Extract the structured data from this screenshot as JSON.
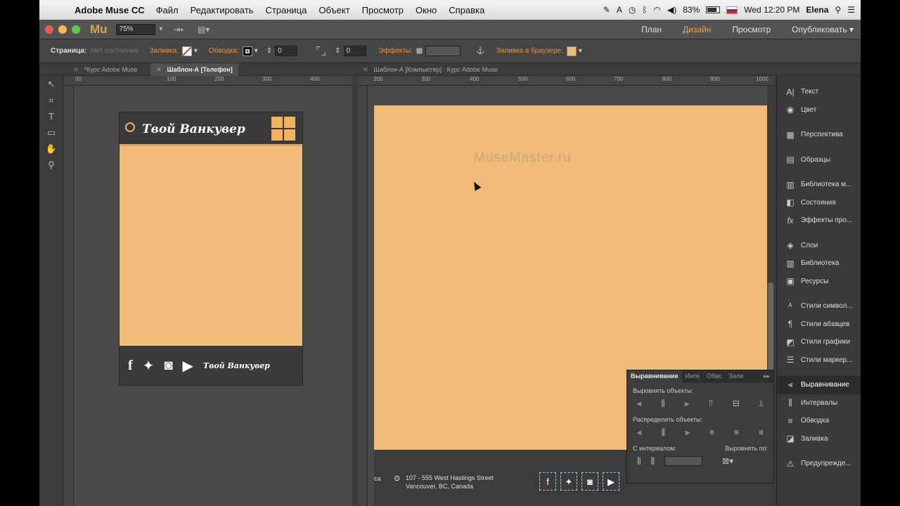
{
  "menubar": {
    "app": "Adobe Muse CC",
    "items": [
      "Файл",
      "Редактировать",
      "Страница",
      "Объект",
      "Просмотр",
      "Окно",
      "Справка"
    ],
    "battery": "83%",
    "clock": "Wed 12:20 PM",
    "user": "Elena"
  },
  "titlebar": {
    "logo": "Mu",
    "zoom": "75%",
    "modes": [
      "План",
      "Дизайн",
      "Просмотр",
      "Опубликовать"
    ],
    "active_mode": "Дизайн"
  },
  "controlbar": {
    "page_label": "Страница:",
    "page_state": "Нет состояния",
    "fill_label": "Заливка:",
    "stroke_label": "Обводка:",
    "stroke_value": "0",
    "corner_value": "0",
    "effects_label": "Эффекты:",
    "browser_fill_label": "Заливка в браузере:",
    "browser_fill_color": "#f0b87a"
  },
  "tabs": {
    "left": [
      {
        "label": "*Курс Adobe Muse",
        "active": false
      },
      {
        "label": "Шаблон-А [Телефон]",
        "active": true
      }
    ],
    "right": [
      {
        "label": "Шаблон-А [Компьютер] : Курс Adobe Muse",
        "active": true
      }
    ]
  },
  "left_ruler": [
    "00",
    "100",
    "200",
    "300",
    "400"
  ],
  "right_ruler": [
    "200",
    "300",
    "400",
    "500",
    "600",
    "700",
    "800",
    "900",
    "1000"
  ],
  "phone": {
    "title": "Твой Ванкувер",
    "footer_brand": "Твой Ванкувер",
    "accent": "#f0b25a"
  },
  "desktop": {
    "watermark": "MuseMaster.ru",
    "address_line1": "107 - 555 West Hastings Street",
    "address_line2": "Vancouver, BC, Canada",
    "cut_text": "ca"
  },
  "align_panel": {
    "tabs": [
      "Выравнивание",
      "Инте",
      "Обвс",
      "Зали"
    ],
    "align_objects": "Выровнять объекты:",
    "distribute_objects": "Распределить объекты:",
    "with_spacing": "С интервалом:",
    "align_to": "Выровнять по:"
  },
  "panels": [
    {
      "label": "Текст",
      "icon": "text-icon"
    },
    {
      "label": "Цвет",
      "icon": "palette-icon"
    },
    {
      "label": "Перспектива",
      "icon": "perspective-icon"
    },
    {
      "label": "Образцы",
      "icon": "swatches-icon"
    },
    {
      "label": "Библиотека м...",
      "icon": "library-icon"
    },
    {
      "label": "Состояния",
      "icon": "states-icon"
    },
    {
      "label": "Эффекты про...",
      "icon": "fx-icon"
    },
    {
      "label": "Слои",
      "icon": "layers-icon"
    },
    {
      "label": "Библиотека",
      "icon": "library-icon"
    },
    {
      "label": "Ресурсы",
      "icon": "assets-icon"
    },
    {
      "label": "Стили символ...",
      "icon": "char-styles-icon"
    },
    {
      "label": "Стили абзацев",
      "icon": "para-styles-icon"
    },
    {
      "label": "Стили графики",
      "icon": "graphic-styles-icon"
    },
    {
      "label": "Стили маркер...",
      "icon": "bullet-styles-icon"
    },
    {
      "label": "Выравнивание",
      "icon": "align-icon"
    },
    {
      "label": "Интервалы",
      "icon": "spacing-icon"
    },
    {
      "label": "Обводка",
      "icon": "stroke-icon"
    },
    {
      "label": "Заливка",
      "icon": "fill-icon"
    },
    {
      "label": "Предупрежде...",
      "icon": "warning-icon"
    }
  ]
}
